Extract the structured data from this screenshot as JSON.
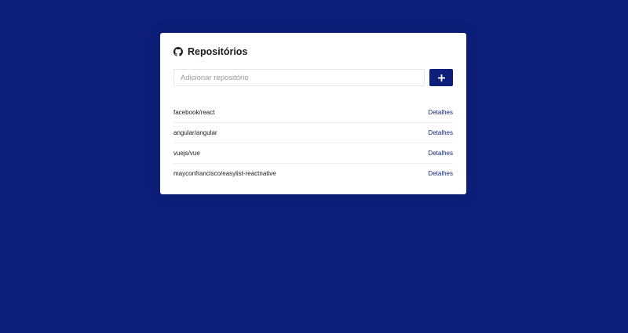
{
  "colors": {
    "background": "#0e1f7a",
    "accent": "#0e1f7a",
    "card": "#ffffff"
  },
  "header": {
    "icon": "github-icon",
    "title": "Repositórios"
  },
  "form": {
    "input_placeholder": "Adicionar repositório",
    "input_value": "",
    "submit_icon": "plus-icon"
  },
  "repositories": [
    {
      "name": "facebook/react",
      "link_label": "Detalhes"
    },
    {
      "name": "angular/angular",
      "link_label": "Detalhes"
    },
    {
      "name": "vuejs/vue",
      "link_label": "Detalhes"
    },
    {
      "name": "mayconfrancisco/easylist-reactnative",
      "link_label": "Detalhes"
    }
  ]
}
